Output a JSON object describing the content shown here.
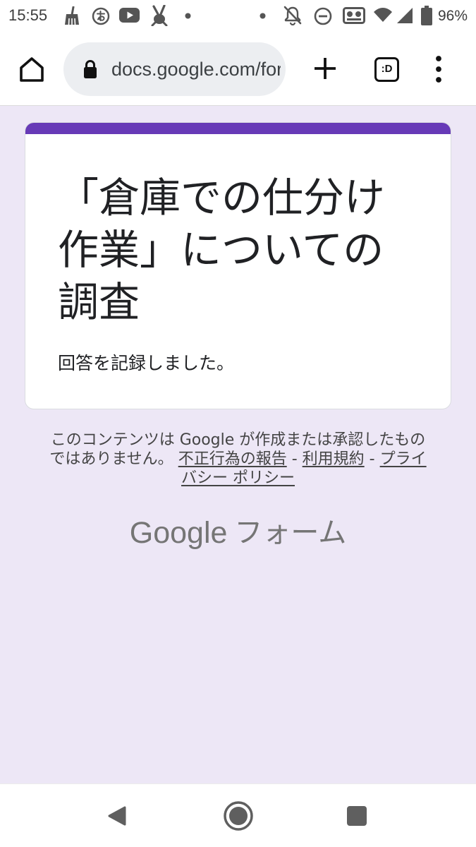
{
  "status_bar": {
    "time": "15:55",
    "battery_text": "96%",
    "notification_icons": [
      "broom-icon",
      "circled-app-icon",
      "youtube-icon",
      "rabbit-icon",
      "more-notifications-dot-icon"
    ],
    "system_icons": [
      "dot-icon",
      "bell-off-icon",
      "do-not-disturb-icon",
      "voicemail-icon",
      "wifi-icon",
      "cellular-signal-icon",
      "battery-icon"
    ],
    "battery_level": 0.96
  },
  "browser": {
    "home_icon": "home-icon",
    "lock_icon": "lock-icon",
    "url": "docs.google.com/for",
    "new_tab_icon": "plus-icon",
    "tab_switcher_label": ":D",
    "menu_icon": "more-vert-icon"
  },
  "form": {
    "theme_color": "#673ab7",
    "background_color": "#ede7f6",
    "title": "「倉庫での仕分け作業」についての調査",
    "confirmation_message": "回答を記録しました。"
  },
  "footer": {
    "disclaimer": "このコンテンツは Google が作成または承認したものではありません。",
    "separator": "-",
    "links": [
      {
        "label": "不正行為の報告"
      },
      {
        "label": "利用規約"
      },
      {
        "label": "プライバシー ポリシー"
      }
    ]
  },
  "branding": {
    "company": "Google",
    "product": "フォーム",
    "color": "#757575"
  },
  "nav_bar": {
    "buttons": [
      "back-icon",
      "home-icon",
      "recents-icon"
    ]
  }
}
